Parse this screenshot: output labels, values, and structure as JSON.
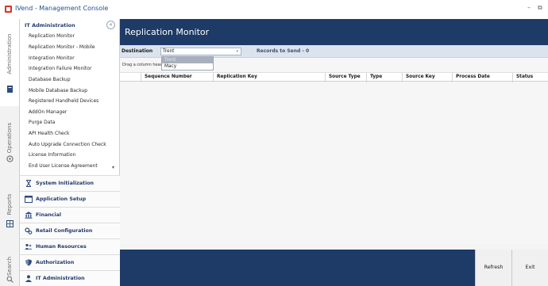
{
  "window": {
    "title": "IVend - Management Console",
    "minimize_label": "–",
    "restore_label": "⧉"
  },
  "left_tabs": [
    {
      "label": "Administration",
      "icon": "admin-icon",
      "active": true
    },
    {
      "label": "Operations",
      "icon": "operations-icon",
      "active": false
    },
    {
      "label": "Reports",
      "icon": "reports-icon",
      "active": false
    },
    {
      "label": "Search",
      "icon": "search-icon",
      "active": false
    }
  ],
  "nav": {
    "header": "IT Administration",
    "collapse_glyph": "«",
    "scroll_glyph": "▾",
    "items": [
      "Replication Monitor",
      "Replication Monitor - Mobile",
      "Integration Monitor",
      "Integration Failure Monitor",
      "Database Backup",
      "Mobile Database Backup",
      "Registered Handheld Devices",
      "AddOn Manager",
      "Purge Data",
      "API Health Check",
      "Auto Upgrade Connection Check",
      "License Information",
      "End User License Agreement"
    ],
    "sections": [
      {
        "label": "System Initialization",
        "icon": "hourglass-icon"
      },
      {
        "label": "Application Setup",
        "icon": "window-icon"
      },
      {
        "label": "Financial",
        "icon": "bank-icon"
      },
      {
        "label": "Retail Configuration",
        "icon": "gears-icon"
      },
      {
        "label": "Human Resources",
        "icon": "people-icon"
      },
      {
        "label": "Authorization",
        "icon": "shield-icon"
      },
      {
        "label": "IT Administration",
        "icon": "user-icon"
      }
    ]
  },
  "main": {
    "title": "Replication Monitor",
    "destination_label": "Destination",
    "destination_value": "Trent",
    "records_label": "Records to Send - 0",
    "dropdown_options": [
      "Trent",
      "Macy"
    ],
    "dropdown_selected_index": 0,
    "group_hint": "Drag a column header",
    "columns": [
      "",
      "Sequence Number",
      "Replication Key",
      "Source Type",
      "Type",
      "Source Key",
      "Process Date",
      "Status"
    ],
    "buttons": {
      "refresh": "Refresh",
      "exit": "Exit"
    }
  },
  "colors": {
    "header_bg": "#1e3a66",
    "toolbar_bg": "#dbe3ee",
    "section_text": "#243a6b",
    "app_icon": "#d9342b"
  }
}
